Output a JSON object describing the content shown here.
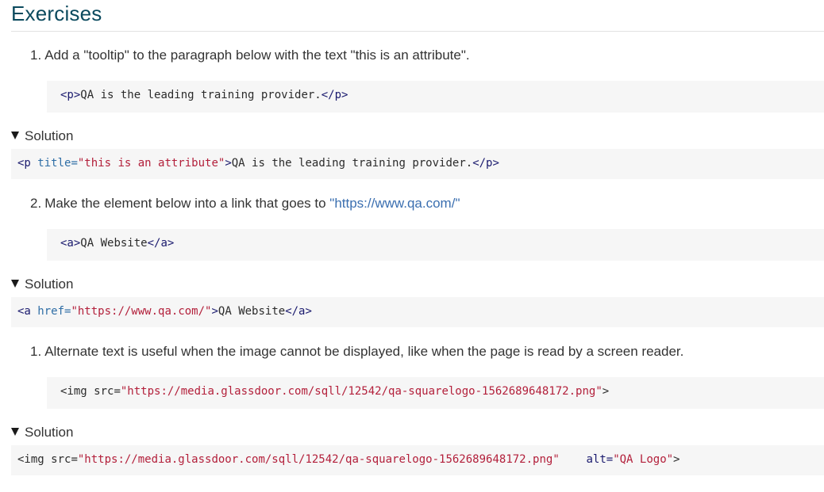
{
  "heading": "Exercises",
  "exercises": [
    {
      "number": "1.",
      "question": "Add a \"tooltip\" to the paragraph below with the text \"this is an attribute\".",
      "code": {
        "open": "<p>",
        "text": "QA is the leading training provider.",
        "close": "</p>"
      },
      "solution_label": "Solution",
      "solution": {
        "tag_open": "<p ",
        "attr": "title=",
        "value": "\"this is an attribute\"",
        "tag_end": ">",
        "text": "QA is the leading training provider.",
        "close": "</p>"
      }
    },
    {
      "number": "2.",
      "question_prefix": "Make the element below into a link that goes to ",
      "link_text": "\"https://www.qa.com/\"",
      "code": {
        "open": "<a>",
        "text": "QA Website",
        "close": "</a>"
      },
      "solution_label": "Solution",
      "solution": {
        "tag_open": "<a ",
        "attr": "href=",
        "value": "\"https://www.qa.com/\"",
        "tag_end": ">",
        "text": "QA Website",
        "close": "</a>"
      }
    },
    {
      "number": "1.",
      "question": "Alternate text is useful when the image cannot be displayed, like when the page is read by a screen reader.",
      "code": {
        "tag_open": "<img ",
        "attr": "src=",
        "value": "\"https://media.glassdoor.com/sqll/12542/qa-squarelogo-1562689648172.png\"",
        "tag_end": ">"
      },
      "solution_label": "Solution",
      "solution": {
        "tag_open": "<img ",
        "attr": "src=",
        "value": "\"https://media.glassdoor.com/sqll/12542/qa-squarelogo-1562689648172.png\"",
        "gap": "    ",
        "attr2": "alt=",
        "value2": "\"QA Logo\"",
        "tag_end": ">"
      }
    }
  ]
}
